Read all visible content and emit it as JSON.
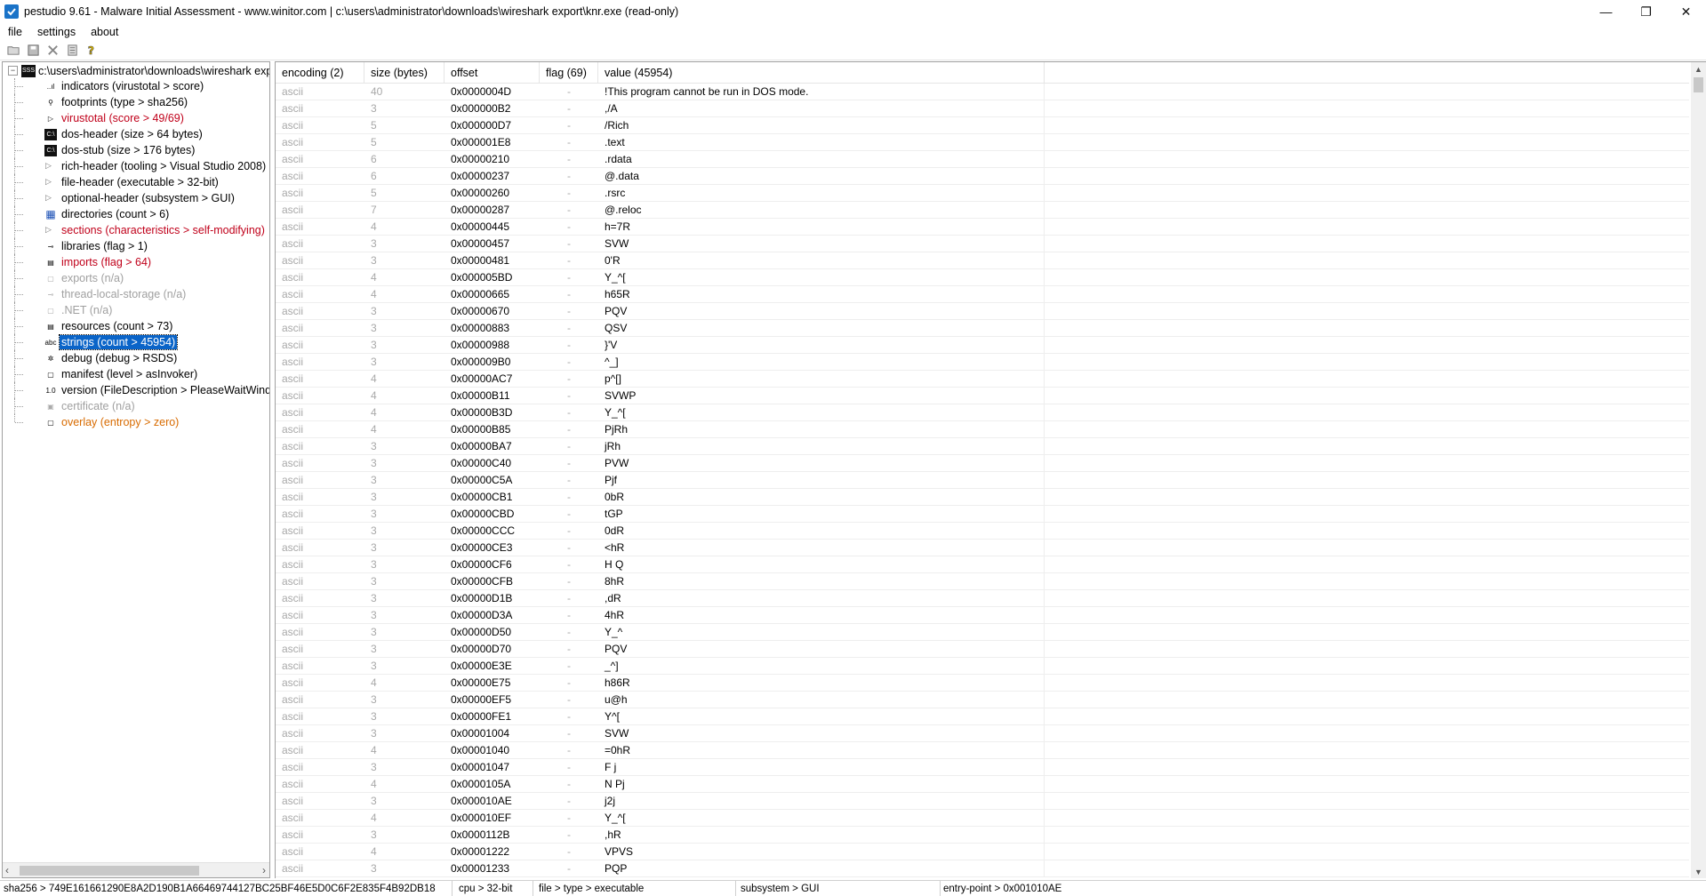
{
  "window": {
    "title": "pestudio 9.61 - Malware Initial Assessment - www.winitor.com | c:\\users\\administrator\\downloads\\wireshark export\\knr.exe (read-only)",
    "minimize": "—",
    "restore": "❐",
    "close": "✕"
  },
  "menu": {
    "file": "file",
    "settings": "settings",
    "about": "about"
  },
  "toolbar": [
    "open-icon",
    "save-icon",
    "close-file-icon",
    "copy-icon",
    "help-icon"
  ],
  "tree": {
    "root": "c:\\users\\administrator\\downloads\\wireshark exp",
    "items": [
      {
        "label": "indicators (virustotal > score)",
        "style": "normal",
        "icon": "indicators-icon",
        "glyph": "..ıl"
      },
      {
        "label": "footprints (type > sha256)",
        "style": "normal",
        "icon": "footprints-icon",
        "glyph": "⚲"
      },
      {
        "label": "virustotal (score > 49/69)",
        "style": "red",
        "icon": "virustotal-icon",
        "glyph": "▷"
      },
      {
        "label": "dos-header (size > 64 bytes)",
        "style": "normal",
        "icon": "dos-header-icon",
        "glyph": "C:\\"
      },
      {
        "label": "dos-stub (size > 176 bytes)",
        "style": "normal",
        "icon": "dos-stub-icon",
        "glyph": "C:\\"
      },
      {
        "label": "rich-header (tooling > Visual Studio 2008)",
        "style": "normal",
        "icon": "rich-header-icon",
        "glyph": ""
      },
      {
        "label": "file-header (executable > 32-bit)",
        "style": "normal",
        "icon": "file-header-icon",
        "glyph": ""
      },
      {
        "label": "optional-header (subsystem > GUI)",
        "style": "normal",
        "icon": "optional-header-icon",
        "glyph": ""
      },
      {
        "label": "directories (count > 6)",
        "style": "normal",
        "icon": "directories-icon",
        "glyph": "▦"
      },
      {
        "label": "sections (characteristics > self-modifying)",
        "style": "red",
        "icon": "sections-icon",
        "glyph": ""
      },
      {
        "label": "libraries (flag > 1)",
        "style": "normal",
        "icon": "libraries-icon",
        "glyph": "⊸"
      },
      {
        "label": "imports (flag > 64)",
        "style": "red",
        "icon": "imports-icon",
        "glyph": "▤"
      },
      {
        "label": "exports (n/a)",
        "style": "gray",
        "icon": "exports-icon",
        "glyph": "▢"
      },
      {
        "label": "thread-local-storage (n/a)",
        "style": "gray",
        "icon": "tls-icon",
        "glyph": "⊸"
      },
      {
        "label": ".NET (n/a)",
        "style": "gray",
        "icon": "dotnet-icon",
        "glyph": "▢"
      },
      {
        "label": "resources (count > 73)",
        "style": "normal",
        "icon": "resources-icon",
        "glyph": "▤"
      },
      {
        "label": "strings (count > 45954)",
        "style": "selected",
        "icon": "strings-icon",
        "glyph": "abc"
      },
      {
        "label": "debug (debug > RSDS)",
        "style": "normal",
        "icon": "debug-icon",
        "glyph": "✲"
      },
      {
        "label": "manifest (level > asInvoker)",
        "style": "normal",
        "icon": "manifest-icon",
        "glyph": "▢"
      },
      {
        "label": "version (FileDescription > PleaseWaitWindow",
        "style": "normal",
        "icon": "version-icon",
        "glyph": "1.0"
      },
      {
        "label": "certificate (n/a)",
        "style": "gray",
        "icon": "certificate-icon",
        "glyph": "▣"
      },
      {
        "label": "overlay (entropy > zero)",
        "style": "orange",
        "icon": "overlay-icon",
        "glyph": "▢"
      }
    ]
  },
  "table": {
    "headers": [
      "encoding (2)",
      "size (bytes)",
      "offset",
      "flag (69)",
      "value (45954)"
    ],
    "rows": [
      [
        "ascii",
        "40",
        "0x0000004D",
        "-",
        "!This program cannot be run in DOS mode."
      ],
      [
        "ascii",
        "3",
        "0x000000B2",
        "-",
        ",/A"
      ],
      [
        "ascii",
        "5",
        "0x000000D7",
        "-",
        "/Rich"
      ],
      [
        "ascii",
        "5",
        "0x000001E8",
        "-",
        ".text"
      ],
      [
        "ascii",
        "6",
        "0x00000210",
        "-",
        ".rdata"
      ],
      [
        "ascii",
        "6",
        "0x00000237",
        "-",
        "@.data"
      ],
      [
        "ascii",
        "5",
        "0x00000260",
        "-",
        ".rsrc"
      ],
      [
        "ascii",
        "7",
        "0x00000287",
        "-",
        "@.reloc"
      ],
      [
        "ascii",
        "4",
        "0x00000445",
        "-",
        "h=7R"
      ],
      [
        "ascii",
        "3",
        "0x00000457",
        "-",
        "SVW"
      ],
      [
        "ascii",
        "3",
        "0x00000481",
        "-",
        "0'R"
      ],
      [
        "ascii",
        "4",
        "0x000005BD",
        "-",
        "Y_^["
      ],
      [
        "ascii",
        "4",
        "0x00000665",
        "-",
        "h65R"
      ],
      [
        "ascii",
        "3",
        "0x00000670",
        "-",
        "PQV"
      ],
      [
        "ascii",
        "3",
        "0x00000883",
        "-",
        "QSV"
      ],
      [
        "ascii",
        "3",
        "0x00000988",
        "-",
        "}'V"
      ],
      [
        "ascii",
        "3",
        "0x000009B0",
        "-",
        "^_]"
      ],
      [
        "ascii",
        "4",
        "0x00000AC7",
        "-",
        "p^[]"
      ],
      [
        "ascii",
        "4",
        "0x00000B11",
        "-",
        "SVWP"
      ],
      [
        "ascii",
        "4",
        "0x00000B3D",
        "-",
        "Y_^["
      ],
      [
        "ascii",
        "4",
        "0x00000B85",
        "-",
        "PjRh"
      ],
      [
        "ascii",
        "3",
        "0x00000BA7",
        "-",
        "jRh"
      ],
      [
        "ascii",
        "3",
        "0x00000C40",
        "-",
        "PVW"
      ],
      [
        "ascii",
        "3",
        "0x00000C5A",
        "-",
        "Pjf"
      ],
      [
        "ascii",
        "3",
        "0x00000CB1",
        "-",
        "0bR"
      ],
      [
        "ascii",
        "3",
        "0x00000CBD",
        "-",
        "tGP"
      ],
      [
        "ascii",
        "3",
        "0x00000CCC",
        "-",
        "0dR"
      ],
      [
        "ascii",
        "3",
        "0x00000CE3",
        "-",
        "<hR"
      ],
      [
        "ascii",
        "3",
        "0x00000CF6",
        "-",
        "H Q"
      ],
      [
        "ascii",
        "3",
        "0x00000CFB",
        "-",
        "8hR"
      ],
      [
        "ascii",
        "3",
        "0x00000D1B",
        "-",
        ",dR"
      ],
      [
        "ascii",
        "3",
        "0x00000D3A",
        "-",
        "4hR"
      ],
      [
        "ascii",
        "3",
        "0x00000D50",
        "-",
        "Y_^"
      ],
      [
        "ascii",
        "3",
        "0x00000D70",
        "-",
        "PQV"
      ],
      [
        "ascii",
        "3",
        "0x00000E3E",
        "-",
        "_^]"
      ],
      [
        "ascii",
        "4",
        "0x00000E75",
        "-",
        "h86R"
      ],
      [
        "ascii",
        "3",
        "0x00000EF5",
        "-",
        "u@h"
      ],
      [
        "ascii",
        "3",
        "0x00000FE1",
        "-",
        "Y^["
      ],
      [
        "ascii",
        "3",
        "0x00001004",
        "-",
        "SVW"
      ],
      [
        "ascii",
        "4",
        "0x00001040",
        "-",
        "=0hR"
      ],
      [
        "ascii",
        "3",
        "0x00001047",
        "-",
        "F j"
      ],
      [
        "ascii",
        "4",
        "0x0000105A",
        "-",
        "N Pj"
      ],
      [
        "ascii",
        "3",
        "0x000010AE",
        "-",
        "j2j"
      ],
      [
        "ascii",
        "4",
        "0x000010EF",
        "-",
        "Y_^["
      ],
      [
        "ascii",
        "3",
        "0x0000112B",
        "-",
        ",hR"
      ],
      [
        "ascii",
        "4",
        "0x00001222",
        "-",
        "VPVS"
      ],
      [
        "ascii",
        "3",
        "0x00001233",
        "-",
        "PQP"
      ]
    ]
  },
  "status": {
    "sha256": "sha256 > 749E161661290E8A2D190B1A66469744127BC25BF46E5D0C6F2E835F4B92DB18",
    "cpu": "cpu > 32-bit",
    "file_type": "file > type > executable",
    "subsystem": "subsystem > GUI",
    "entry_point": "entry-point > 0x001010AE"
  }
}
